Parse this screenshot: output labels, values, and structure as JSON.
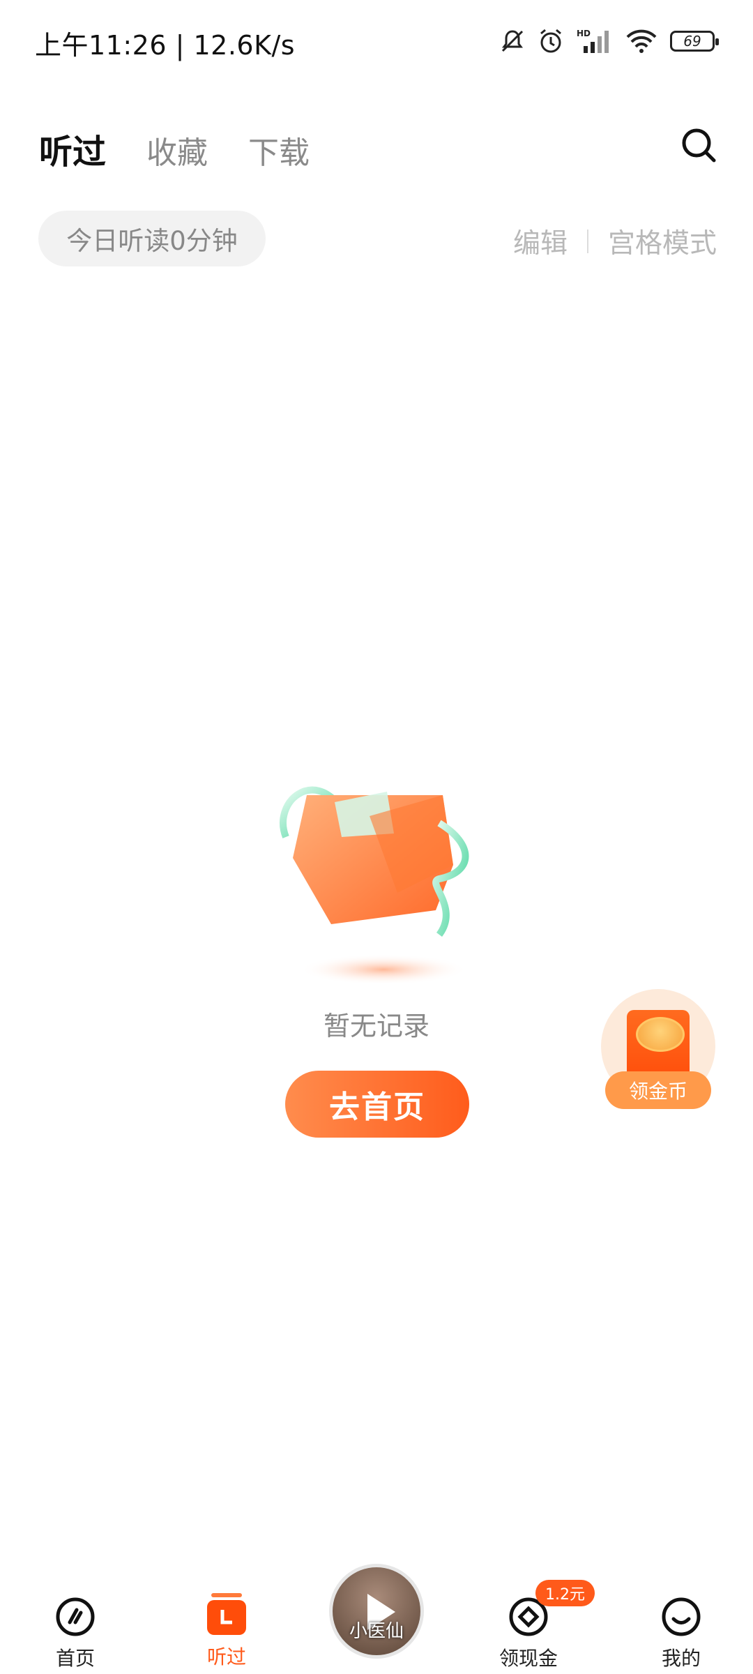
{
  "status_bar": {
    "time": "上午11:26 | 12.6K/s",
    "battery": "69",
    "icons": [
      "mute-bell-icon",
      "alarm-icon",
      "hd-signal-icon",
      "wifi-icon",
      "battery-icon"
    ]
  },
  "header": {
    "tabs": [
      {
        "label": "听过",
        "active": true
      },
      {
        "label": "收藏",
        "active": false
      },
      {
        "label": "下载",
        "active": false
      }
    ],
    "search_icon": "search-icon"
  },
  "stats": {
    "today_listen": "今日听读0分钟",
    "edit": "编辑",
    "grid_mode": "宫格模式"
  },
  "empty_state": {
    "message": "暂无记录",
    "button": "去首页"
  },
  "floating": {
    "coin_label": "领金币"
  },
  "bottom_nav": {
    "items": [
      {
        "label": "首页",
        "icon": "home-icon"
      },
      {
        "label": "听过",
        "icon": "listened-icon",
        "active": true
      },
      {
        "label": "小医仙",
        "icon": "play-icon"
      },
      {
        "label": "领现金",
        "icon": "cash-icon",
        "badge": "1.2元"
      },
      {
        "label": "我的",
        "icon": "profile-icon"
      }
    ]
  },
  "colors": {
    "accent": "#ff5a1a",
    "text_primary": "#111111",
    "text_muted": "#888888"
  }
}
